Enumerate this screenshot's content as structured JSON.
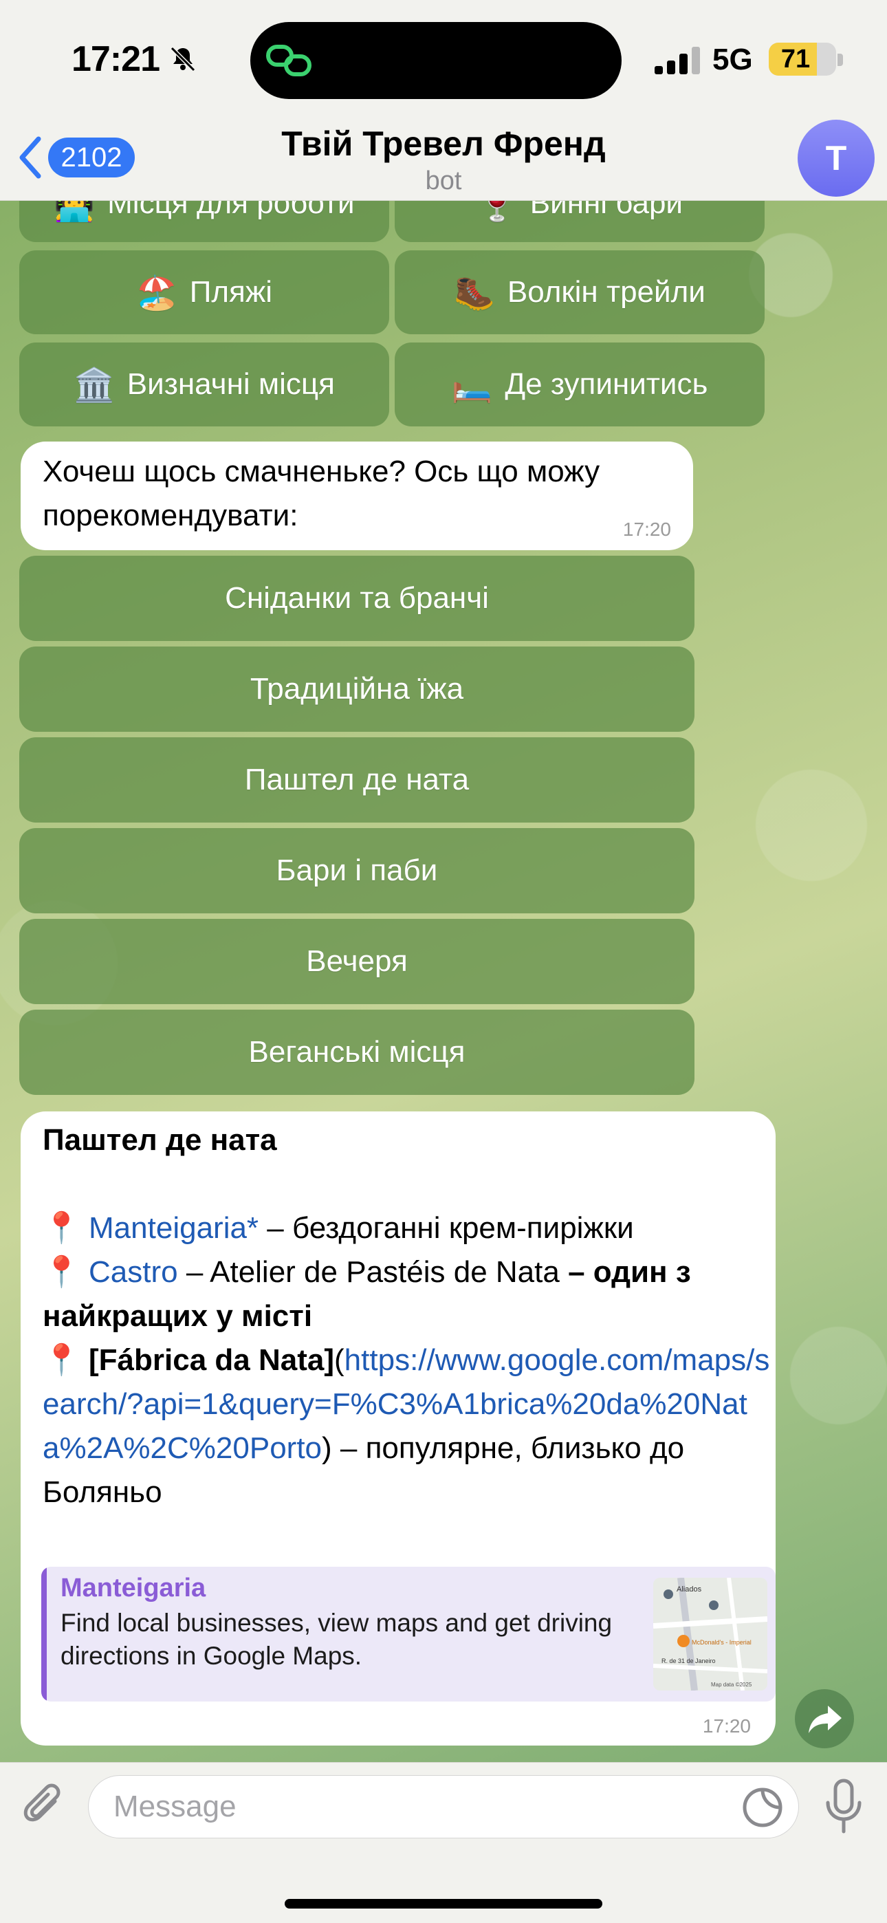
{
  "status_bar": {
    "time": "17:21",
    "network": "5G",
    "battery_percent": "71",
    "battery_level": 0.71
  },
  "header": {
    "back_count": "2102",
    "title": "Твій Тревел Френд",
    "subtitle": "bot",
    "avatar_letter": "T"
  },
  "top_keyboard": {
    "row0": [
      {
        "emoji": "👩‍💻",
        "label": "Місця для роботи"
      },
      {
        "emoji": "🍷",
        "label": "Винні бари"
      }
    ],
    "row1": [
      {
        "emoji": "🏖️",
        "label": "Пляжі"
      },
      {
        "emoji": "🥾",
        "label": "Волкін трейли"
      }
    ],
    "row2": [
      {
        "emoji": "🏛️",
        "label": "Визначні місця"
      },
      {
        "emoji": "🛏️",
        "label": "Де зупинитись"
      }
    ]
  },
  "food_message": {
    "text": "Хочеш щось смачненьке? Ось що можу порекомендувати:",
    "time": "17:20"
  },
  "food_keyboard": [
    "Сніданки та бранчі",
    "Традиційна їжа",
    "Паштел де ната",
    "Бари і паби",
    "Вечеря",
    "Веганські місця"
  ],
  "pastel_message": {
    "title": "Паштел де ната",
    "pin": "📍",
    "line1_link": "Manteigaria*",
    "line1_text": " – бездоганні крем-пиріжки",
    "line2_link": "Castro",
    "line2_text": " – Atelier de Pastéis de Nata ",
    "line2_bold": "– один з найкращих у місті",
    "line3_bold": "[Fábrica da Nata]",
    "line3_paren_open": "(",
    "line3_url": "https://www.google.com/maps/search/?api=1&query=F%C3%A1brica%20da%20Nata%2A%2C%20Porto",
    "line3_text": ") – популярне, близько до Боляньо",
    "time": "17:20",
    "preview": {
      "site": "Manteigaria",
      "description": "Find local businesses, view maps and get driving directions in Google Maps.",
      "map_labels": [
        "Aliados",
        "McDonald's - Imperial",
        "R. de 31 de Janeiro",
        "Map data ©2025"
      ]
    }
  },
  "input": {
    "placeholder": "Message"
  },
  "icons": {
    "back": "chevron-left-icon",
    "attach": "paperclip-icon",
    "sticker": "sticker-icon",
    "mic": "microphone-icon",
    "share": "forward-icon",
    "mute": "bell-slash-icon"
  },
  "colors": {
    "accent": "#3478f6",
    "link": "#1e5ab4",
    "preview_accent": "#8a5cd6",
    "keyboard_button": "#5e8c46"
  }
}
